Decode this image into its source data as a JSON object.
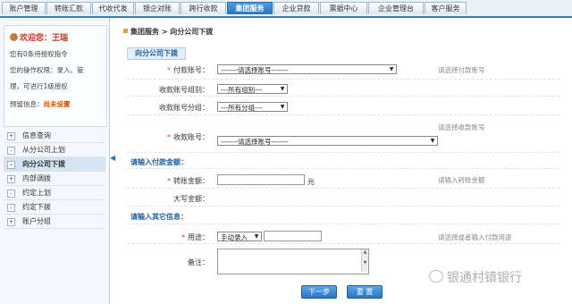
{
  "top_tabs": [
    "账户管理",
    "转账汇款",
    "代收代发",
    "银企对账",
    "跨行收款",
    "集团服务",
    "企业贷款",
    "票据中心",
    "企业管理台",
    "客户服务"
  ],
  "active_tab_index": 5,
  "welcome": {
    "hello": "欢迎您：王瑞",
    "line1": "您有0条待授权指令",
    "line2": "您的操作权限：录入、管",
    "line3": "理，可进行1级授权",
    "line4_label": "预留信息：",
    "line4_value": "尚未设置"
  },
  "menu": [
    {
      "label": "信息查询",
      "mark": "+"
    },
    {
      "label": "从分公司上划",
      "mark": "-"
    },
    {
      "label": "向分公司下拨",
      "mark": "-"
    },
    {
      "label": "内部调拨",
      "mark": "+"
    },
    {
      "label": "约定上划",
      "mark": "-"
    },
    {
      "label": "约定下拨",
      "mark": "-"
    },
    {
      "label": "账户分组",
      "mark": "+"
    }
  ],
  "active_menu_index": 2,
  "breadcrumb": "集团服务 > 向分公司下拨",
  "section_title": "向分公司下拨",
  "form": {
    "pay_account_label": "付款账号：",
    "pay_account_value": "-------请选择账号-------",
    "pay_account_hint": "请选择付款账号",
    "recv_group_label": "收款账号组别：",
    "recv_group_value": "---所有组别---",
    "recv_subgroup_label": "收款账号分组：",
    "recv_subgroup_value": "---所有分组---",
    "recv_account_label": "收款账号：",
    "recv_account_value": "-------请选择账号-------",
    "recv_account_hint": "请选择收款账号",
    "amount_group": "请输入付款金额：",
    "amount_label": "转账金额：",
    "amount_unit": "元",
    "amount_hint": "请输入转账金额",
    "upper_label": "大写金额：",
    "other_group": "请输入其它信息：",
    "purpose_label": "用途：",
    "purpose_value": "手动录入",
    "purpose_hint": "请选择或者输入付款用途",
    "remark_label": "备注："
  },
  "buttons": {
    "next": "下一步",
    "reset": "重 置"
  },
  "watermark": "银通村镇银行"
}
